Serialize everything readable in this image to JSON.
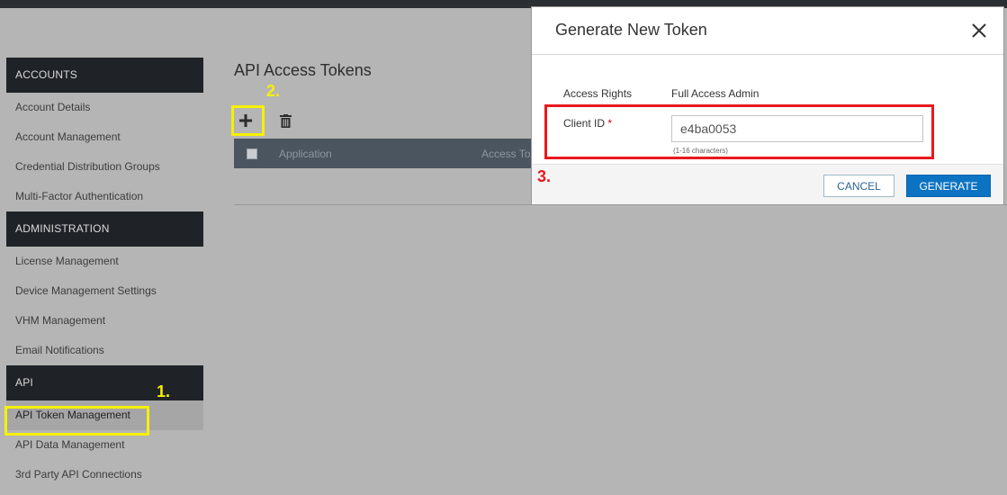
{
  "sidebar": {
    "sections": [
      {
        "title": "ACCOUNTS",
        "items": [
          "Account Details",
          "Account Management",
          "Credential Distribution Groups",
          "Multi-Factor Authentication"
        ]
      },
      {
        "title": "ADMINISTRATION",
        "items": [
          "License Management",
          "Device Management Settings",
          "VHM Management",
          "Email Notifications"
        ]
      },
      {
        "title": "API",
        "items": [
          "API Token Management",
          "API Data Management",
          "3rd Party API Connections"
        ]
      }
    ],
    "active_item": "API Token Management"
  },
  "main": {
    "title": "API Access Tokens",
    "toolbar": {
      "add_icon": "plus-icon",
      "delete_icon": "trash-icon"
    },
    "table": {
      "columns": [
        "Application",
        "Access To"
      ]
    }
  },
  "modal": {
    "title": "Generate New Token",
    "access_rights_label": "Access Rights",
    "access_rights_value": "Full Access Admin",
    "client_id_label": "Client ID",
    "required_marker": "*",
    "client_id_value": "e4ba0053",
    "client_id_hint": "(1-16 characters)",
    "cancel_label": "CANCEL",
    "generate_label": "GENERATE",
    "close_icon": "close-icon"
  },
  "annotations": {
    "step1": "1.",
    "step2": "2.",
    "step3": "3.",
    "highlight_yellow": "#f6f000",
    "highlight_red": "#e8191c"
  },
  "colors": {
    "sidebar_header": "#1f2327",
    "primary_button": "#0c73c2",
    "overlay": "#b5b5b5"
  }
}
